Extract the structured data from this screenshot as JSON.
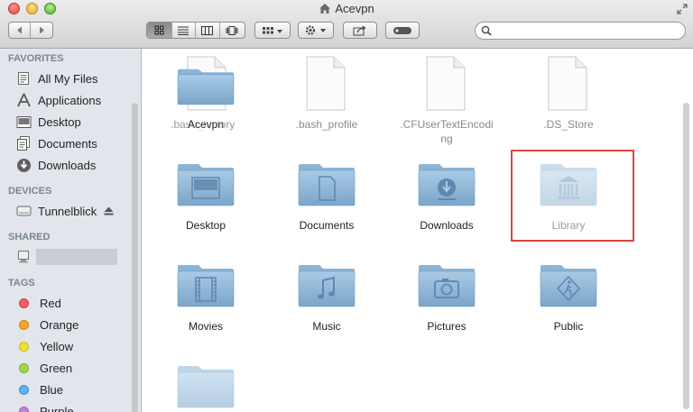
{
  "window": {
    "title": "Acevpn"
  },
  "search": {
    "placeholder": ""
  },
  "sidebar": {
    "favorites_header": "FAVORITES",
    "favorites": [
      {
        "label": "All My Files",
        "icon": "all-files-icon"
      },
      {
        "label": "Applications",
        "icon": "applications-icon"
      },
      {
        "label": "Desktop",
        "icon": "desktop-icon"
      },
      {
        "label": "Documents",
        "icon": "documents-icon"
      },
      {
        "label": "Downloads",
        "icon": "downloads-icon"
      }
    ],
    "devices_header": "DEVICES",
    "devices": [
      {
        "label": "Tunnelblick",
        "icon": "disk-icon",
        "eject": "eject-icon"
      }
    ],
    "shared_header": "SHARED",
    "tags_header": "TAGS",
    "tags": [
      {
        "label": "Red",
        "color": "#f1605a"
      },
      {
        "label": "Orange",
        "color": "#f5a623"
      },
      {
        "label": "Yellow",
        "color": "#f1e130"
      },
      {
        "label": "Green",
        "color": "#a3d548"
      },
      {
        "label": "Blue",
        "color": "#5fb0f3"
      },
      {
        "label": "Purple",
        "color": "#c57fde"
      }
    ]
  },
  "files": [
    {
      "label": "Acevpn",
      "sublabel": ".bash_history"
    },
    {
      "label": ".bash_profile"
    },
    {
      "label": ".CFUserTextEncoding"
    },
    {
      "label": ".DS_Store"
    },
    {
      "label": "Desktop"
    },
    {
      "label": "Documents"
    },
    {
      "label": "Downloads"
    },
    {
      "label": "Library"
    },
    {
      "label": "Movies"
    },
    {
      "label": "Music"
    },
    {
      "label": "Pictures"
    },
    {
      "label": "Public"
    }
  ],
  "colors": {
    "folder": "#8fb6d6",
    "highlight": "#d9473f",
    "sidebar": "#e2e6ec"
  }
}
